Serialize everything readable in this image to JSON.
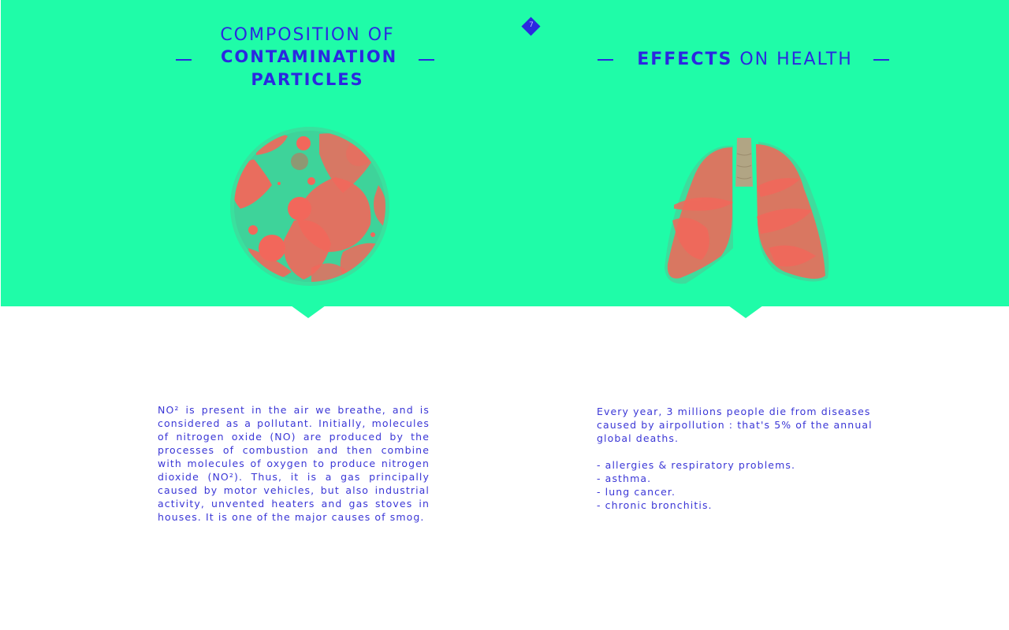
{
  "page": {
    "number": "7",
    "colors": {
      "background": "#1ffca8",
      "accent": "#2b28e0",
      "illustration": "#f2675b"
    }
  },
  "left": {
    "heading_light": "COMPOSITION OF",
    "heading_bold": "CONTAMINATION PARTICLES",
    "illustration_icon": "particle-sphere-icon",
    "paragraph": "NO² is present in the air we breathe, and is considered as a pollutant. Initially, molecules of nitrogen oxide (NO) are produced by the processes of combustion and then combine with molecules of oxygen to produce nitrogen dioxide (NO²). Thus, it is a gas principally caused by motor vehicles, but also industrial activity, unvented heaters and gas stoves in houses. It is one of the major causes of smog."
  },
  "right": {
    "heading_bold": "EFFECTS",
    "heading_light": "ON HEALTH",
    "illustration_icon": "lungs-icon",
    "paragraph_lines": [
      "Every year, 3 millions people die from diseases",
      "caused by airpollution : that's 5% of the annual",
      "global deaths."
    ],
    "effects": [
      "- allergies & respiratory problems.",
      "- asthma.",
      "- lung cancer.",
      "- chronic bronchitis."
    ]
  }
}
